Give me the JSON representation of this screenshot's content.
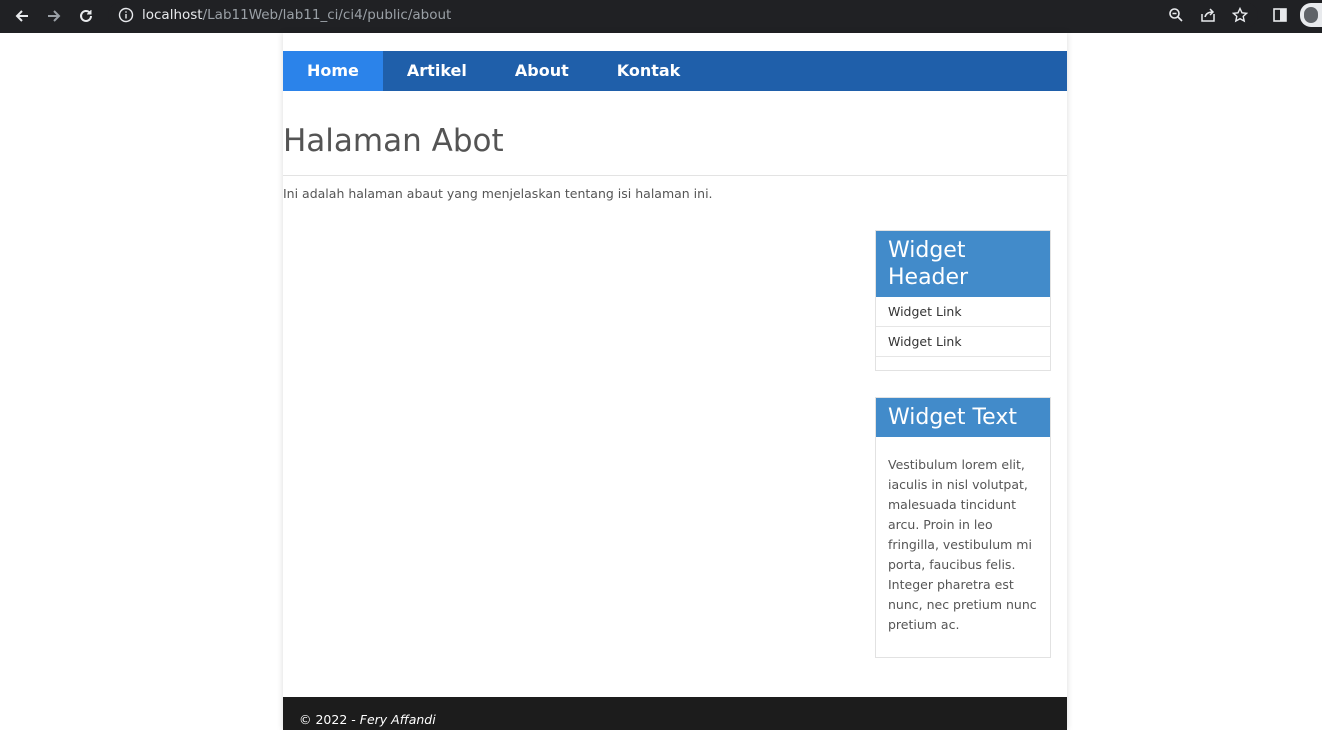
{
  "browser": {
    "url_host": "localhost",
    "url_path": "/Lab11Web/lab11_ci/ci4/public/about"
  },
  "nav": {
    "items": [
      {
        "label": "Home",
        "active": true
      },
      {
        "label": "Artikel",
        "active": false
      },
      {
        "label": "About",
        "active": false
      },
      {
        "label": "Kontak",
        "active": false
      }
    ]
  },
  "main": {
    "title": "Halaman Abot",
    "intro": "Ini adalah halaman abaut yang menjelaskan tentang isi halaman ini."
  },
  "sidebar": {
    "widget1": {
      "header": "Widget Header",
      "links": [
        "Widget Link",
        "Widget Link"
      ]
    },
    "widget2": {
      "header": "Widget Text",
      "text": "Vestibulum lorem elit, iaculis in nisl volutpat, malesuada tincidunt arcu. Proin in leo fringilla, vestibulum mi porta, faucibus felis. Integer pharetra est nunc, nec pretium nunc pretium ac."
    }
  },
  "footer": {
    "prefix": "© 2022 - ",
    "author": "Fery Affandi"
  },
  "colors": {
    "nav_bg": "#1f5faa",
    "nav_active": "#2b83ea",
    "widget_header": "#428bca",
    "footer_bg": "#1c1c1c"
  },
  "icons": [
    "back-arrow-icon",
    "forward-arrow-icon",
    "reload-icon",
    "info-icon",
    "zoom-icon",
    "share-icon",
    "star-icon",
    "side-panel-icon",
    "profile-avatar-icon"
  ]
}
